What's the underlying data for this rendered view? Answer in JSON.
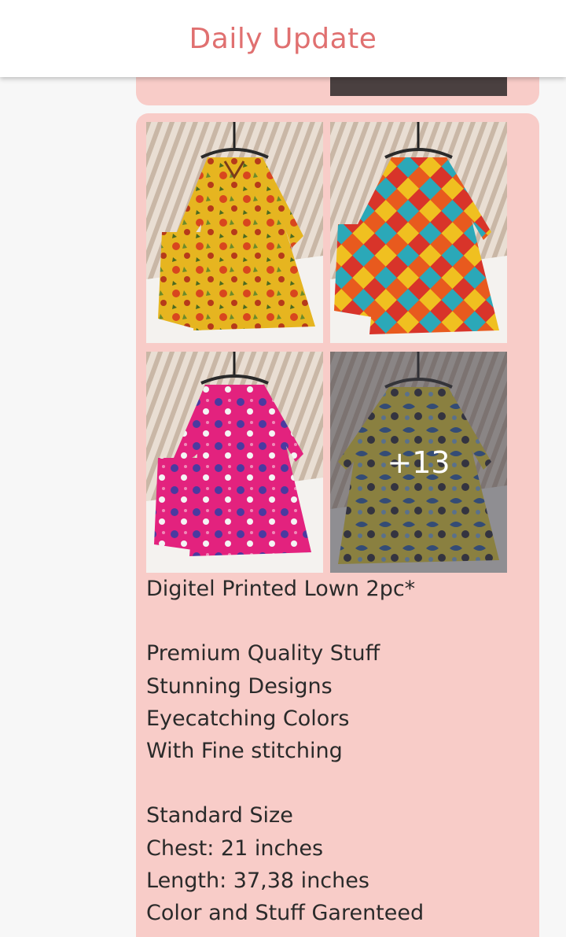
{
  "header": {
    "title": "Daily Update"
  },
  "post": {
    "more_count": "+13",
    "description": "Digitel Printed Lown 2pc*\n\nPremium Quality Stuff\nStunning Designs\nEyecatching Colors\nWith Fine stitching\n\nStandard Size\nChest: 21 inches\nLength: 37,38 inches\nColor and Stuff Garenteed"
  },
  "colors": {
    "title": "#e07070",
    "card": "#f8ccc8"
  }
}
